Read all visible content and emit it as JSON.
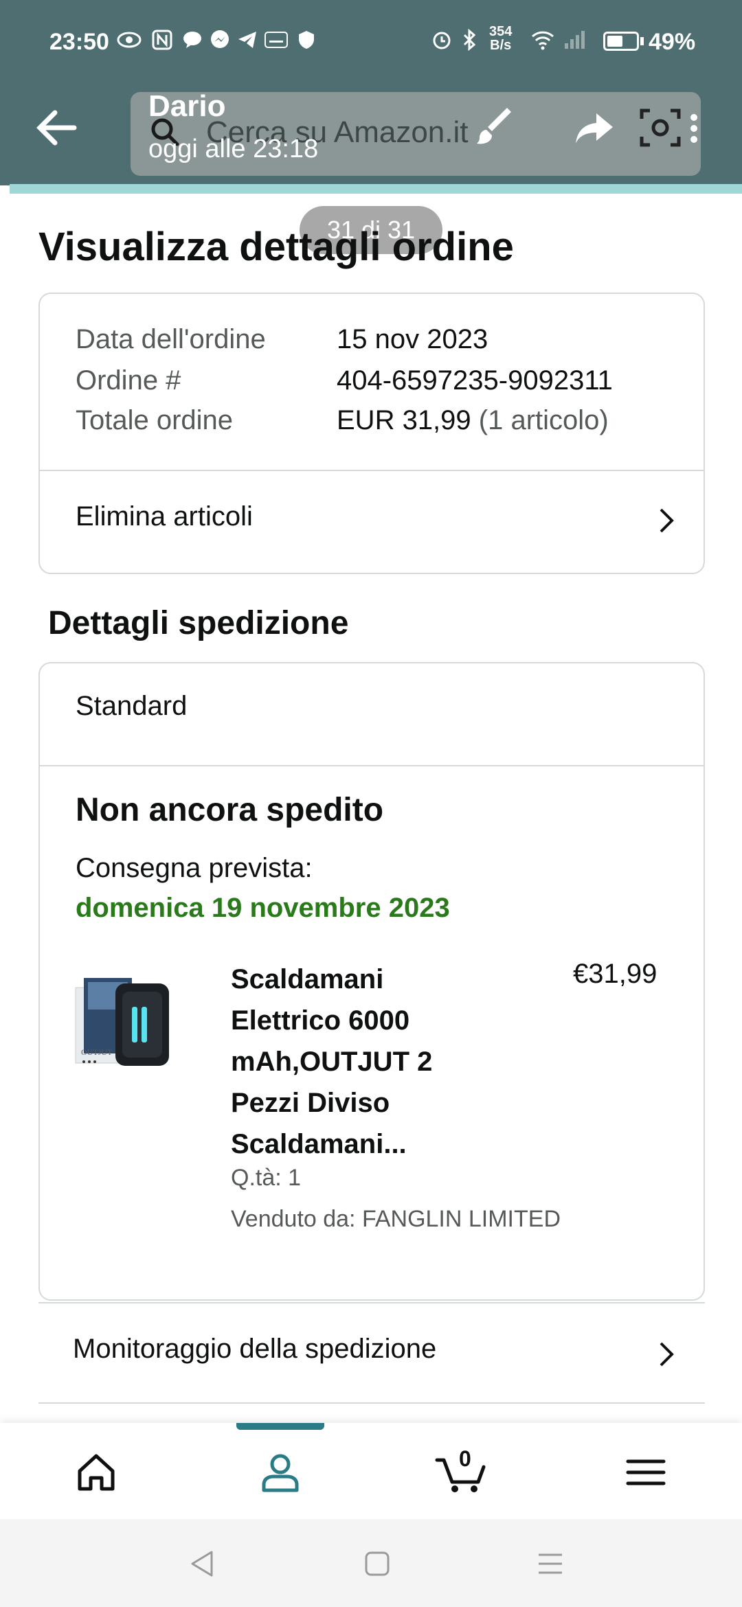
{
  "status_bar": {
    "time": "23:50",
    "speed_value": "354",
    "speed_unit": "B/s",
    "battery": "49%"
  },
  "viewer": {
    "sender": "Dario",
    "sent_time": "oggi alle 23:18",
    "search_placeholder": "Cerca su Amazon.it",
    "page_counter": "31 di 31"
  },
  "page": {
    "title": "Visualizza dettagli ordine"
  },
  "order_summary": {
    "rows": [
      {
        "label": "Data dell'ordine",
        "value": "15 nov 2023",
        "extra": ""
      },
      {
        "label": "Ordine #",
        "value": "404-6597235-9092311",
        "extra": ""
      },
      {
        "label": "Totale ordine",
        "value": "EUR 31,99",
        "extra": "(1 articolo)"
      }
    ],
    "action": "Elimina articoli"
  },
  "shipping": {
    "section_title": "Dettagli spedizione",
    "method": "Standard",
    "status": "Non ancora spedito",
    "delivery_label": "Consegna prevista:",
    "delivery_date": "domenica 19 novembre 2023",
    "product": {
      "name": "Scaldamani Elettrico 6000 mAh,OUTJUT 2 Pezzi Diviso Scaldamani...",
      "price": "€31,99",
      "qty": "Q.tà: 1",
      "seller": "Venduto da: FANGLIN LIMITED"
    },
    "tracking": "Monitoraggio della spedizione"
  },
  "bottom_nav": {
    "cart_count": "0",
    "items": [
      "home-icon",
      "account-icon",
      "cart-icon",
      "menu-icon"
    ]
  },
  "colors": {
    "accent": "#297b86",
    "delivery_green": "#2a7a1c",
    "header_bg": "#4f6e71"
  }
}
